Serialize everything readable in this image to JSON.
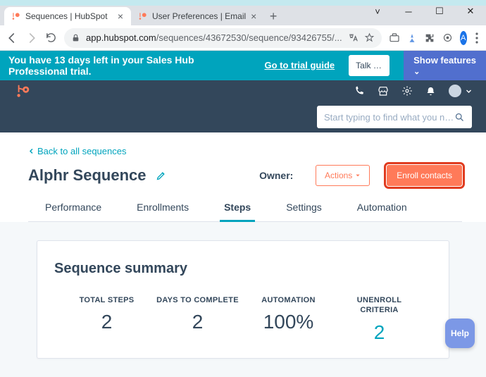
{
  "window": {
    "controls": {
      "min": "─",
      "max": "☐",
      "close": "✕",
      "down": "˅"
    }
  },
  "browser": {
    "tabs": [
      {
        "title": "Sequences | HubSpot",
        "active": true
      },
      {
        "title": "User Preferences | Email",
        "active": false
      }
    ],
    "url_domain": "app.hubspot.com",
    "url_path": "/sequences/43672530/sequence/93426755/...",
    "avatar_letter": "A"
  },
  "trial": {
    "text": "You have 13 days left in your Sales Hub Professional trial.",
    "guide": "Go to trial guide",
    "talk": "Talk to Sa...",
    "features": "Show features"
  },
  "search": {
    "placeholder": "Start typing to find what you need"
  },
  "page": {
    "back": "Back to all sequences",
    "title": "Alphr Sequence",
    "owner_label": "Owner:",
    "actions": "Actions",
    "enroll": "Enroll contacts",
    "tabs": [
      "Performance",
      "Enrollments",
      "Steps",
      "Settings",
      "Automation"
    ],
    "active_tab": 2
  },
  "summary": {
    "title": "Sequence summary",
    "stats": [
      {
        "label": "TOTAL STEPS",
        "value": "2"
      },
      {
        "label": "DAYS TO COMPLETE",
        "value": "2"
      },
      {
        "label": "AUTOMATION",
        "value": "100%"
      },
      {
        "label": "UNENROLL CRITERIA",
        "value": "2"
      }
    ]
  },
  "help": "Help"
}
